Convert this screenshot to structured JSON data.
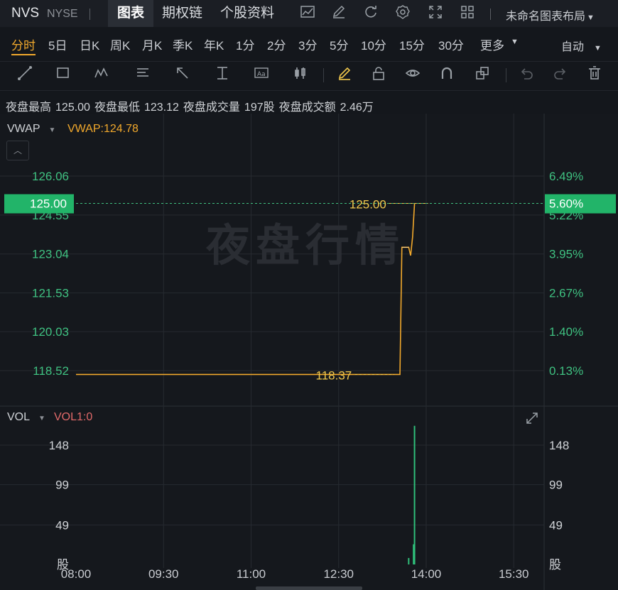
{
  "header": {
    "ticker": "NVS",
    "exchange": "NYSE",
    "tabs": [
      "图表",
      "期权链",
      "个股资料"
    ],
    "icons": [
      "chart-line-icon",
      "edit-icon",
      "refresh-icon",
      "gear-icon",
      "fullscreen-icon",
      "grid-layout-icon"
    ],
    "layout_name": "未命名图表布局"
  },
  "periods": {
    "items": [
      "分时",
      "5日",
      "日K",
      "周K",
      "月K",
      "季K",
      "年K",
      "1分",
      "2分",
      "3分",
      "5分",
      "10分",
      "15分",
      "30分",
      "更多"
    ],
    "active": "分时",
    "mode": "自动"
  },
  "toolbar": {
    "tools": [
      "trend-line-icon",
      "rectangle-icon",
      "pattern-icon",
      "fib-icon",
      "arrow-icon",
      "measure-icon",
      "text-icon",
      "candle-icon",
      "pen-icon",
      "lock-icon",
      "eye-icon",
      "magnet-icon",
      "clone-icon",
      "undo-icon",
      "redo-icon",
      "trash-icon"
    ]
  },
  "stats": {
    "items": [
      {
        "label": "夜盘最高",
        "value": "125.00"
      },
      {
        "label": "夜盘最低",
        "value": "123.12"
      },
      {
        "label": "夜盘成交量",
        "value": "197股"
      },
      {
        "label": "夜盘成交额",
        "value": "2.46万"
      }
    ]
  },
  "indicator": {
    "name": "VWAP",
    "value_label": "VWAP:124.78"
  },
  "volume": {
    "name": "VOL",
    "value_label": "VOL1:0"
  },
  "watermark": "夜盘行情",
  "colors": {
    "price_line": "#f2a92c",
    "axis_text": "#3fc181",
    "current_badge": "#22b469",
    "volume_bar": "#2fbf7a",
    "grid": "#262a30"
  },
  "chart_data": [
    {
      "type": "line",
      "title": "",
      "x": [
        "08:00",
        "09:30",
        "11:00",
        "12:30",
        "14:00",
        "15:30"
      ],
      "ylim": [
        117.9,
        127.2
      ],
      "y_ticks": [
        126.06,
        124.55,
        123.04,
        121.53,
        120.03,
        118.52
      ],
      "pct_ticks": [
        "6.49%",
        "5.22%",
        "3.95%",
        "2.67%",
        "1.40%",
        "0.13%"
      ],
      "current_price": "125.00",
      "current_pct": "5.60%",
      "series": [
        {
          "points": [
            [
              "08:00",
              118.37
            ],
            [
              "13:33",
              118.37
            ],
            [
              "13:35",
              123.3
            ],
            [
              "13:42",
              123.3
            ],
            [
              "13:44",
              122.98
            ],
            [
              "13:46",
              123.7
            ],
            [
              "13:48",
              125.0
            ]
          ]
        }
      ],
      "annotations": [
        {
          "text": "118.37",
          "at": [
            "12:25",
            118.37
          ]
        },
        {
          "text": "125.00",
          "at": [
            "13:00",
            125.0
          ]
        }
      ]
    },
    {
      "type": "bar",
      "title": "",
      "ylim": [
        0,
        175
      ],
      "y_ticks": [
        "148",
        "99",
        "49",
        "股"
      ],
      "bars": [
        {
          "x": "13:42",
          "value": 8
        },
        {
          "x": "13:47",
          "value": 25
        },
        {
          "x": "13:48",
          "value": 172
        }
      ]
    }
  ]
}
